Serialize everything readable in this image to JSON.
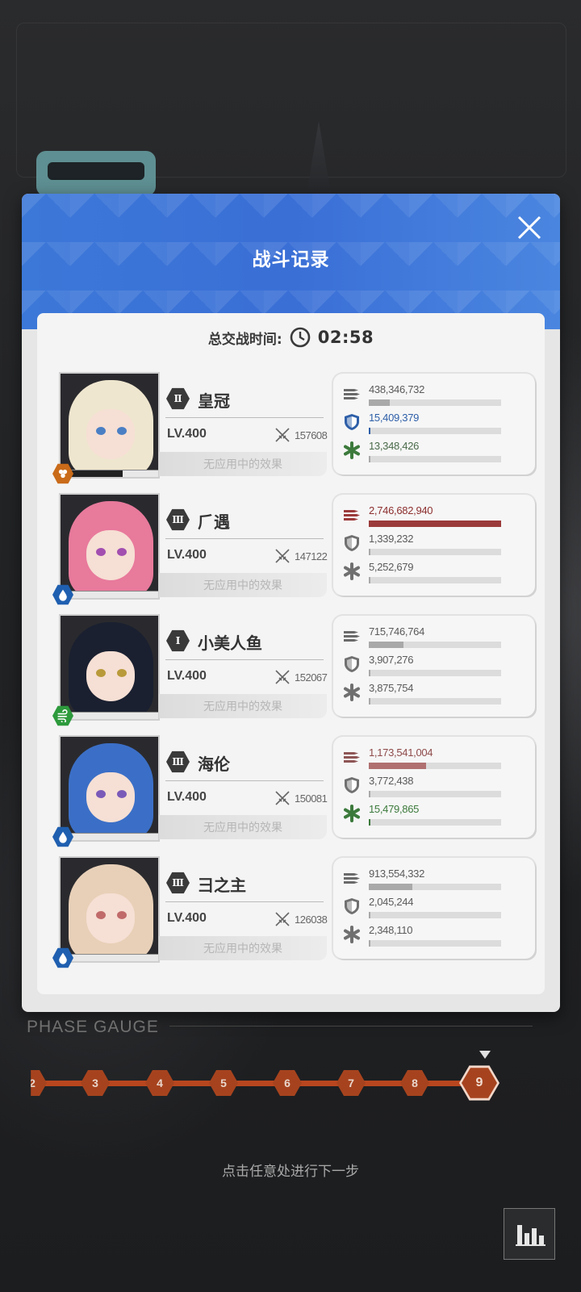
{
  "dialog": {
    "title": "战斗记录",
    "total_time_label": "总交战时间:",
    "total_time_value": "02:58",
    "close_icon": "close-x-icon"
  },
  "colors": {
    "header_blue": "#3c78d8",
    "damage_high": "#9b3a3a",
    "shield_blue": "#2e5fa8",
    "heal_green": "#3c7a3c",
    "gauge_orange": "#a6431e"
  },
  "units": [
    {
      "rank": "Ⅱ",
      "name": "皇冠",
      "level": "LV.400",
      "power": "157608",
      "effect_text": "无应用中的效果",
      "element": "iron",
      "damage": {
        "value": "438,346,732",
        "ratio": 0.16,
        "highlight": false
      },
      "shield": {
        "value": "15,409,379",
        "ratio": 0.01,
        "highlight": true
      },
      "heal": {
        "value": "13,348,426",
        "ratio": 0.01,
        "highlight": false
      }
    },
    {
      "rank": "Ⅲ",
      "name": "⺁遇",
      "level": "LV.400",
      "power": "147122",
      "effect_text": "无应用中的效果",
      "element": "water",
      "damage": {
        "value": "2,746,682,940",
        "ratio": 1.0,
        "highlight": true
      },
      "shield": {
        "value": "1,339,232",
        "ratio": 0.0,
        "highlight": false
      },
      "heal": {
        "value": "5,252,679",
        "ratio": 0.0,
        "highlight": false
      }
    },
    {
      "rank": "Ⅰ",
      "name": "小美人鱼",
      "level": "LV.400",
      "power": "152067",
      "effect_text": "无应用中的效果",
      "element": "wind",
      "damage": {
        "value": "715,746,764",
        "ratio": 0.26,
        "highlight": false
      },
      "shield": {
        "value": "3,907,276",
        "ratio": 0.0,
        "highlight": false
      },
      "heal": {
        "value": "3,875,754",
        "ratio": 0.0,
        "highlight": false
      }
    },
    {
      "rank": "Ⅲ",
      "name": "海伦",
      "level": "LV.400",
      "power": "150081",
      "effect_text": "无应用中的效果",
      "element": "water",
      "damage": {
        "value": "1,173,541,004",
        "ratio": 0.43,
        "highlight": "mid"
      },
      "shield": {
        "value": "3,772,438",
        "ratio": 0.0,
        "highlight": false
      },
      "heal": {
        "value": "15,479,865",
        "ratio": 0.01,
        "highlight": true
      }
    },
    {
      "rank": "Ⅲ",
      "name": "⺕之主",
      "level": "LV.400",
      "power": "126038",
      "effect_text": "无应用中的效果",
      "element": "water",
      "damage": {
        "value": "913,554,332",
        "ratio": 0.33,
        "highlight": false
      },
      "shield": {
        "value": "2,045,244",
        "ratio": 0.0,
        "highlight": false
      },
      "heal": {
        "value": "2,348,110",
        "ratio": 0.0,
        "highlight": false
      }
    }
  ],
  "phase": {
    "title": "PHASE GAUGE",
    "nodes": [
      "2",
      "3",
      "4",
      "5",
      "6",
      "7",
      "8",
      "9"
    ],
    "current": "9"
  },
  "hint": "点击任意处进行下一步",
  "stats_button_icon": "bar-chart-icon"
}
